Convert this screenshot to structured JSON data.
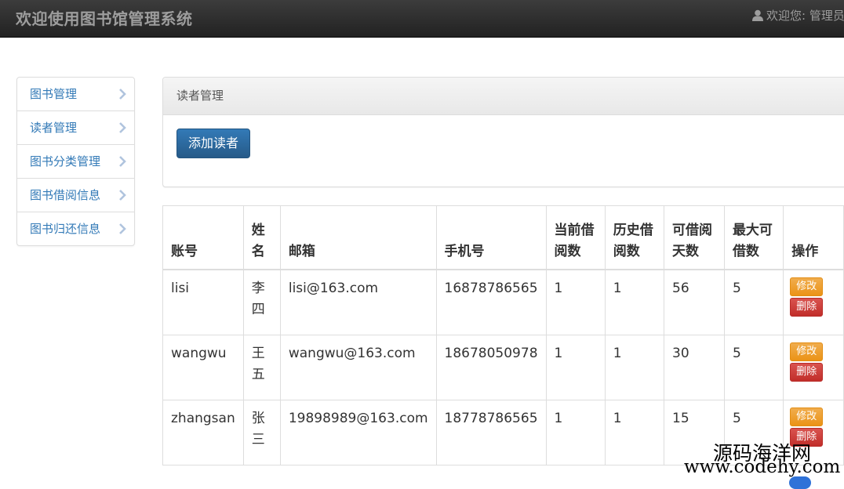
{
  "header": {
    "brand": "欢迎使用图书馆管理系统",
    "user_greeting": "欢迎您: 管理员"
  },
  "sidebar": {
    "items": [
      {
        "label": "图书管理"
      },
      {
        "label": "读者管理"
      },
      {
        "label": "图书分类管理"
      },
      {
        "label": "图书借阅信息"
      },
      {
        "label": "图书归还信息"
      }
    ]
  },
  "panel": {
    "title": "读者管理",
    "add_button": "添加读者"
  },
  "table": {
    "headers": {
      "account": "账号",
      "name": "姓名",
      "email": "邮箱",
      "phone": "手机号",
      "current_borrow": "当前借阅数",
      "history_borrow": "历史借阅数",
      "borrow_days": "可借阅天数",
      "max_borrow": "最大可借数",
      "actions": "操作"
    },
    "rows": [
      {
        "account": "lisi",
        "name": "李四",
        "email": "lisi@163.com",
        "phone": "16878786565",
        "current_borrow": "1",
        "history_borrow": "1",
        "borrow_days": "56",
        "max_borrow": "5"
      },
      {
        "account": "wangwu",
        "name": "王五",
        "email": "wangwu@163.com",
        "phone": "18678050978",
        "current_borrow": "1",
        "history_borrow": "1",
        "borrow_days": "30",
        "max_borrow": "5"
      },
      {
        "account": "zhangsan",
        "name": "张三",
        "email": "19898989@163.com",
        "phone": "18778786565",
        "current_borrow": "1",
        "history_borrow": "1",
        "borrow_days": "15",
        "max_borrow": "5"
      }
    ],
    "edit_label": "修改",
    "delete_label": "删除"
  },
  "watermark": {
    "cn": "源码海洋网",
    "en": "www.codehy.com"
  },
  "colors": {
    "link": "#337ab7",
    "primary": "#286090",
    "warning": "#f0ad4e",
    "danger": "#d9534f",
    "navbar": "#222222"
  }
}
